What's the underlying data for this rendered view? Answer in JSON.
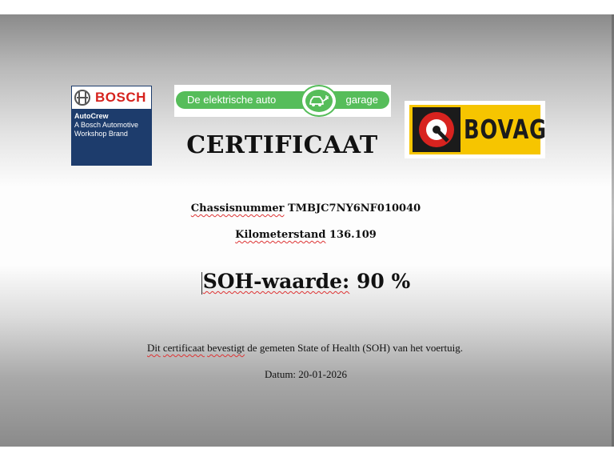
{
  "logos": {
    "bosch": {
      "brand": "BOSCH",
      "line1": "AutoCrew",
      "line2": "A Bosch Automotive",
      "line3": "Workshop Brand",
      "background": "#1d3c6c",
      "brand_color": "#d6231e"
    },
    "garage": {
      "left_text": "De elektrische auto",
      "right_text": "garage",
      "icon": "electric-car-plug-icon",
      "color": "#56bd5a"
    },
    "bovag": {
      "brand": "BOVAG",
      "icon": "bovag-emblem-icon",
      "color": "#f6c500"
    }
  },
  "certificate": {
    "title": "CERTIFICAAT",
    "chassis_label": "Chassisnummer",
    "chassis_value": "TMBJC7NY6NF010040",
    "km_label": "Kilometerstand",
    "km_value": "136.109",
    "soh_label": "SOH-waarde:",
    "soh_value": "90",
    "soh_unit": "%",
    "desc_part1": "Dit",
    "desc_part2": "certificaat",
    "desc_part3": "bevestigt",
    "desc_part4": "de gemeten State of Health (SOH) van het voertuig.",
    "datum": "Datum: 20-01-2026"
  }
}
